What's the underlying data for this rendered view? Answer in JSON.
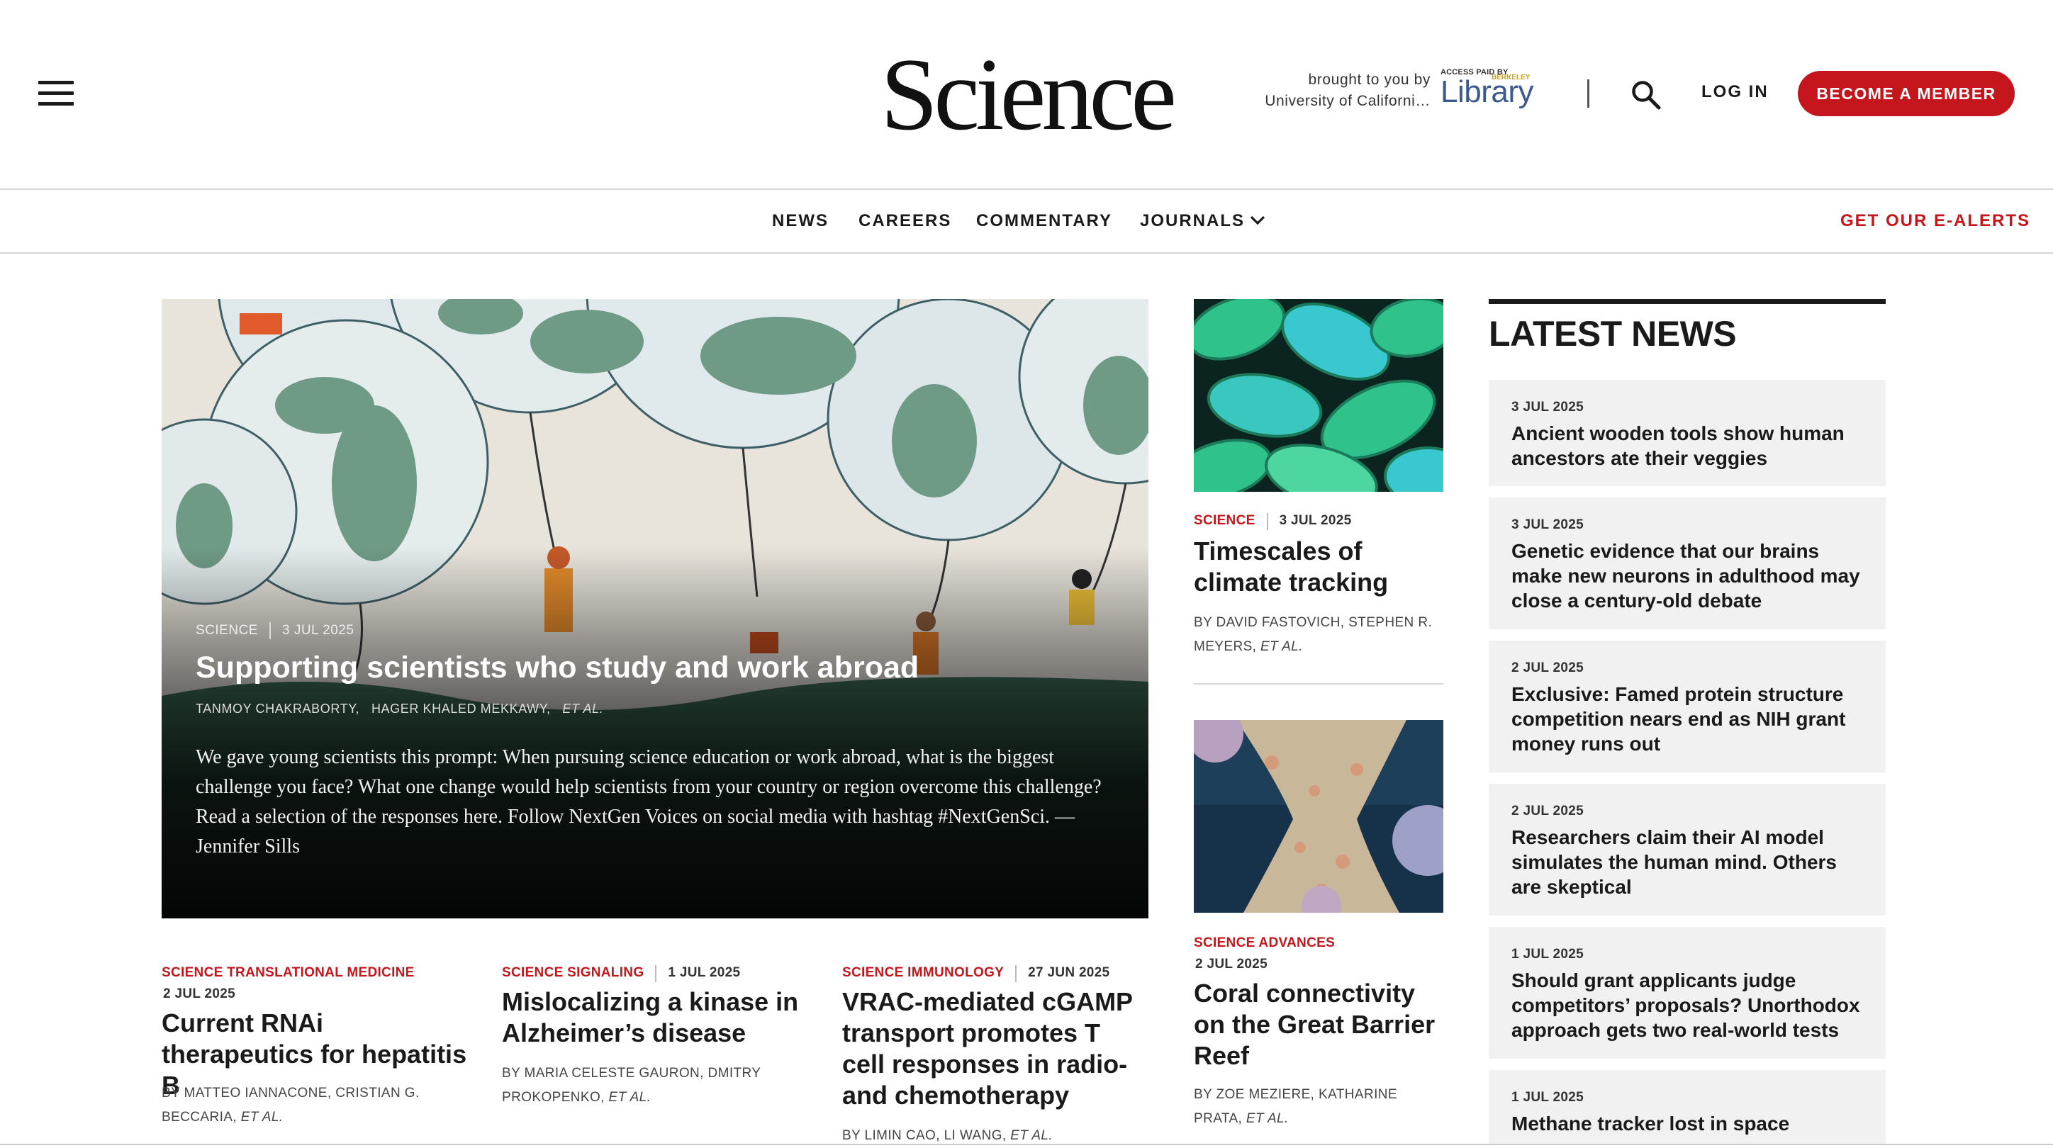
{
  "header": {
    "logo": "Science",
    "brought_line1": "brought to you by",
    "brought_line2": "University of Californi…",
    "library_small": "ACCESS PAID BY",
    "library_sub": "BERKELEY",
    "library_name": "Library",
    "login": "LOG IN",
    "member": "BECOME A MEMBER"
  },
  "nav": {
    "items": [
      "NEWS",
      "CAREERS",
      "COMMENTARY",
      "JOURNALS"
    ],
    "alerts": "GET OUR E-ALERTS"
  },
  "hero": {
    "kicker": "SCIENCE",
    "date": "3 JUL 2025",
    "title": "Supporting scientists who study and work abroad",
    "authors": [
      "TANMOY CHAKRABORTY,",
      "HAGER KHALED MEKKAWY,",
      "ET AL."
    ],
    "description": "We gave young scientists this prompt: When pursuing science education or work abroad, what is the biggest challenge you face? What one change would help scientists from your country or region overcome this challenge? Read a selection of the responses here. Follow NextGen Voices on social media with hashtag #NextGenSci. —Jennifer Sills"
  },
  "side_cards": [
    {
      "kicker": "SCIENCE",
      "date": "3 JUL 2025",
      "title": "Timescales of climate tracking",
      "byline": "BY DAVID FASTOVICH,  STEPHEN R. MEYERS,",
      "etal": "ET AL."
    },
    {
      "kicker": "SCIENCE ADVANCES",
      "date": "2 JUL 2025",
      "title": "Coral connectivity on the Great Barrier Reef",
      "byline": "BY ZOE MEZIERE,  KATHARINE PRATA,",
      "etal": "ET AL."
    }
  ],
  "bottom_cards": [
    {
      "kicker": "SCIENCE TRANSLATIONAL MEDICINE",
      "date": "2 JUL 2025",
      "title": "Current RNAi therapeutics for hepatitis B",
      "byline": "BY MATTEO IANNACONE,  CRISTIAN G. BECCARIA,",
      "etal": "ET AL."
    },
    {
      "kicker": "SCIENCE SIGNALING",
      "date": "1 JUL 2025",
      "title": "Mislocalizing a kinase in Alzheimer’s disease",
      "byline": "BY MARIA CELESTE GAURON,  DMITRY PROKOPENKO,",
      "etal": "ET AL."
    },
    {
      "kicker": "SCIENCE IMMUNOLOGY",
      "date": "27 JUN 2025",
      "title": "VRAC-mediated cGAMP transport promotes T cell responses in radio- and chemotherapy",
      "byline": "BY LIMIN CAO,  LI WANG,",
      "etal": "ET AL."
    }
  ],
  "latest_news": {
    "heading": "LATEST NEWS",
    "items": [
      {
        "date": "3 JUL 2025",
        "title": "Ancient wooden tools show human ancestors ate their veggies"
      },
      {
        "date": "3 JUL 2025",
        "title": "Genetic evidence that our brains make new neurons in adulthood may close a century-old debate"
      },
      {
        "date": "2 JUL 2025",
        "title": "Exclusive: Famed protein structure competition nears end as NIH grant money runs out"
      },
      {
        "date": "2 JUL 2025",
        "title": "Researchers claim their AI model simulates the human mind. Others are skeptical"
      },
      {
        "date": "1 JUL 2025",
        "title": "Should grant applicants judge competitors’ proposals? Unorthodox approach gets two real-world tests"
      },
      {
        "date": "1 JUL 2025",
        "title": "Methane tracker lost in space"
      }
    ]
  },
  "colors": {
    "brand_red": "#c4161c",
    "text": "#1a1a1a",
    "card_bg": "#f1f1f1"
  },
  "icons": [
    "hamburger-menu-icon",
    "search-icon",
    "chevron-down-icon"
  ]
}
